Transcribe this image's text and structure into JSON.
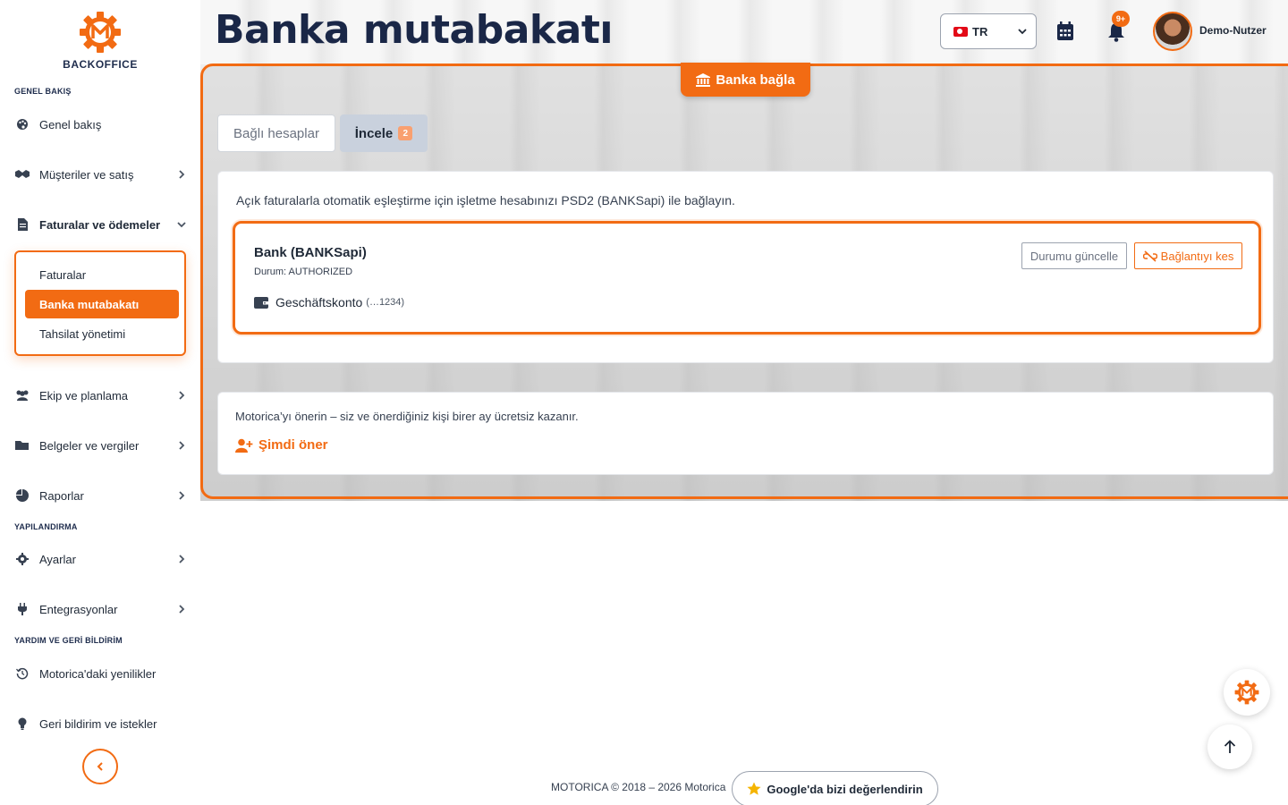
{
  "app": {
    "logo_text": "BACKOFFICE",
    "brand_color": "#f26b13"
  },
  "sidebar": {
    "sections": [
      {
        "title": "GENEL BAKIŞ"
      },
      {
        "title": "YAPILANDIRMA"
      },
      {
        "title": "YARDIM VE GERİ BİLDİRİM"
      }
    ],
    "items": [
      {
        "label": "Genel bakış",
        "icon": "palette-icon"
      },
      {
        "label": "Müşteriler ve satış",
        "icon": "handshake-icon"
      },
      {
        "label": "Faturalar ve ödemeler",
        "icon": "invoice-icon"
      },
      {
        "label": "Ekip ve planlama",
        "icon": "users-icon"
      },
      {
        "label": "Belgeler ve vergiler",
        "icon": "folder-icon"
      },
      {
        "label": "Raporlar",
        "icon": "pie-chart-icon"
      },
      {
        "label": "Ayarlar",
        "icon": "gear-icon"
      },
      {
        "label": "Entegrasyonlar",
        "icon": "plug-icon"
      },
      {
        "label": "Motorica'daki yenilikler",
        "icon": "history-icon"
      },
      {
        "label": "Geri bildirim ve istekler",
        "icon": "lightbulb-icon"
      }
    ],
    "submenu": [
      {
        "label": "Faturalar"
      },
      {
        "label": "Banka mutabakatı",
        "active": true
      },
      {
        "label": "Tahsilat yönetimi"
      }
    ]
  },
  "header": {
    "title": "Banka mutabakatı",
    "language": "TR",
    "notification_badge": "9+",
    "user_name": "Demo-Nutzer"
  },
  "main": {
    "connect_button": "Banka bağla",
    "tabs": [
      {
        "label": "Bağlı hesaplar"
      },
      {
        "label": "İncele",
        "badge": "2"
      }
    ],
    "intro": "Açık faturalarla otomatik eşleştirme için işletme hesabınızı PSD2 (BANKSapi) ile bağlayın.",
    "bank": {
      "title": "Bank (BANKSapi)",
      "status": "Durum: AUTHORIZED",
      "account_name": "Geschäftskonto",
      "account_suffix": "(…1234)",
      "refresh_button": "Durumu güncelle",
      "disconnect_button": "Bağlantıyı kes"
    },
    "referral": {
      "text": "Motorica’yı önerin – siz ve önerdiğiniz kişi birer ay ücretsiz kazanır.",
      "link": "Şimdi öner"
    }
  },
  "footer": {
    "copyright": "MOTORICA © 2018 – 2026 Motorica",
    "google_button": "Google'da bizi değerlendirin"
  }
}
